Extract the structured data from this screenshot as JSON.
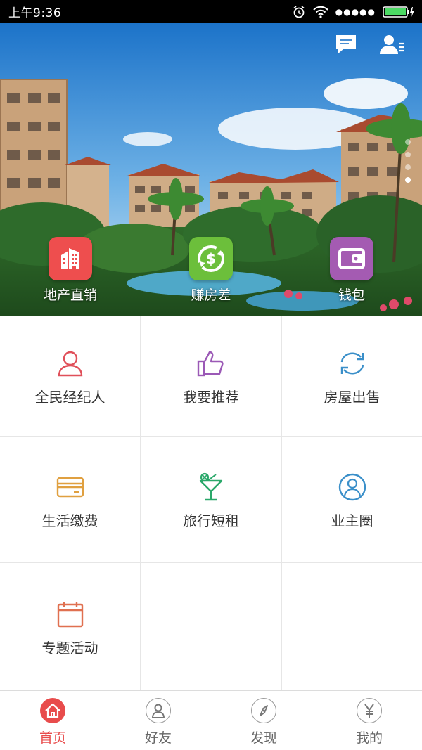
{
  "status_bar": {
    "time": "上午9:36",
    "signal_dots": "●●●●●"
  },
  "banner": {
    "pager": {
      "count": 4,
      "active_index": 3
    },
    "quick_actions": [
      {
        "label": "地产直销",
        "icon": "building-icon",
        "color": "#ee4e4e"
      },
      {
        "label": "赚房差",
        "icon": "dollar-cycle-icon",
        "color": "#6cbf3b"
      },
      {
        "label": "钱包",
        "icon": "wallet-icon",
        "color": "#a45bb2"
      }
    ]
  },
  "grid": [
    {
      "label": "全民经纪人",
      "icon": "person-icon",
      "color": "#e0505a"
    },
    {
      "label": "我要推荐",
      "icon": "thumbs-up-icon",
      "color": "#9b59b6"
    },
    {
      "label": "房屋出售",
      "icon": "refresh-arrows-icon",
      "color": "#3a8fc9"
    },
    {
      "label": "生活缴费",
      "icon": "card-icon",
      "color": "#e0a040"
    },
    {
      "label": "旅行短租",
      "icon": "cocktail-icon",
      "color": "#2aa86a"
    },
    {
      "label": "业主圈",
      "icon": "user-circle-icon",
      "color": "#3a8fc9"
    },
    {
      "label": "专题活动",
      "icon": "calendar-icon",
      "color": "#e07050"
    }
  ],
  "tabbar": [
    {
      "label": "首页",
      "icon": "home-icon",
      "active": true
    },
    {
      "label": "好友",
      "icon": "friend-icon",
      "active": false
    },
    {
      "label": "发现",
      "icon": "compass-icon",
      "active": false
    },
    {
      "label": "我的",
      "icon": "yen-icon",
      "active": false
    }
  ],
  "colors": {
    "accent": "#e84c4c",
    "divider": "#e6e6e6"
  }
}
